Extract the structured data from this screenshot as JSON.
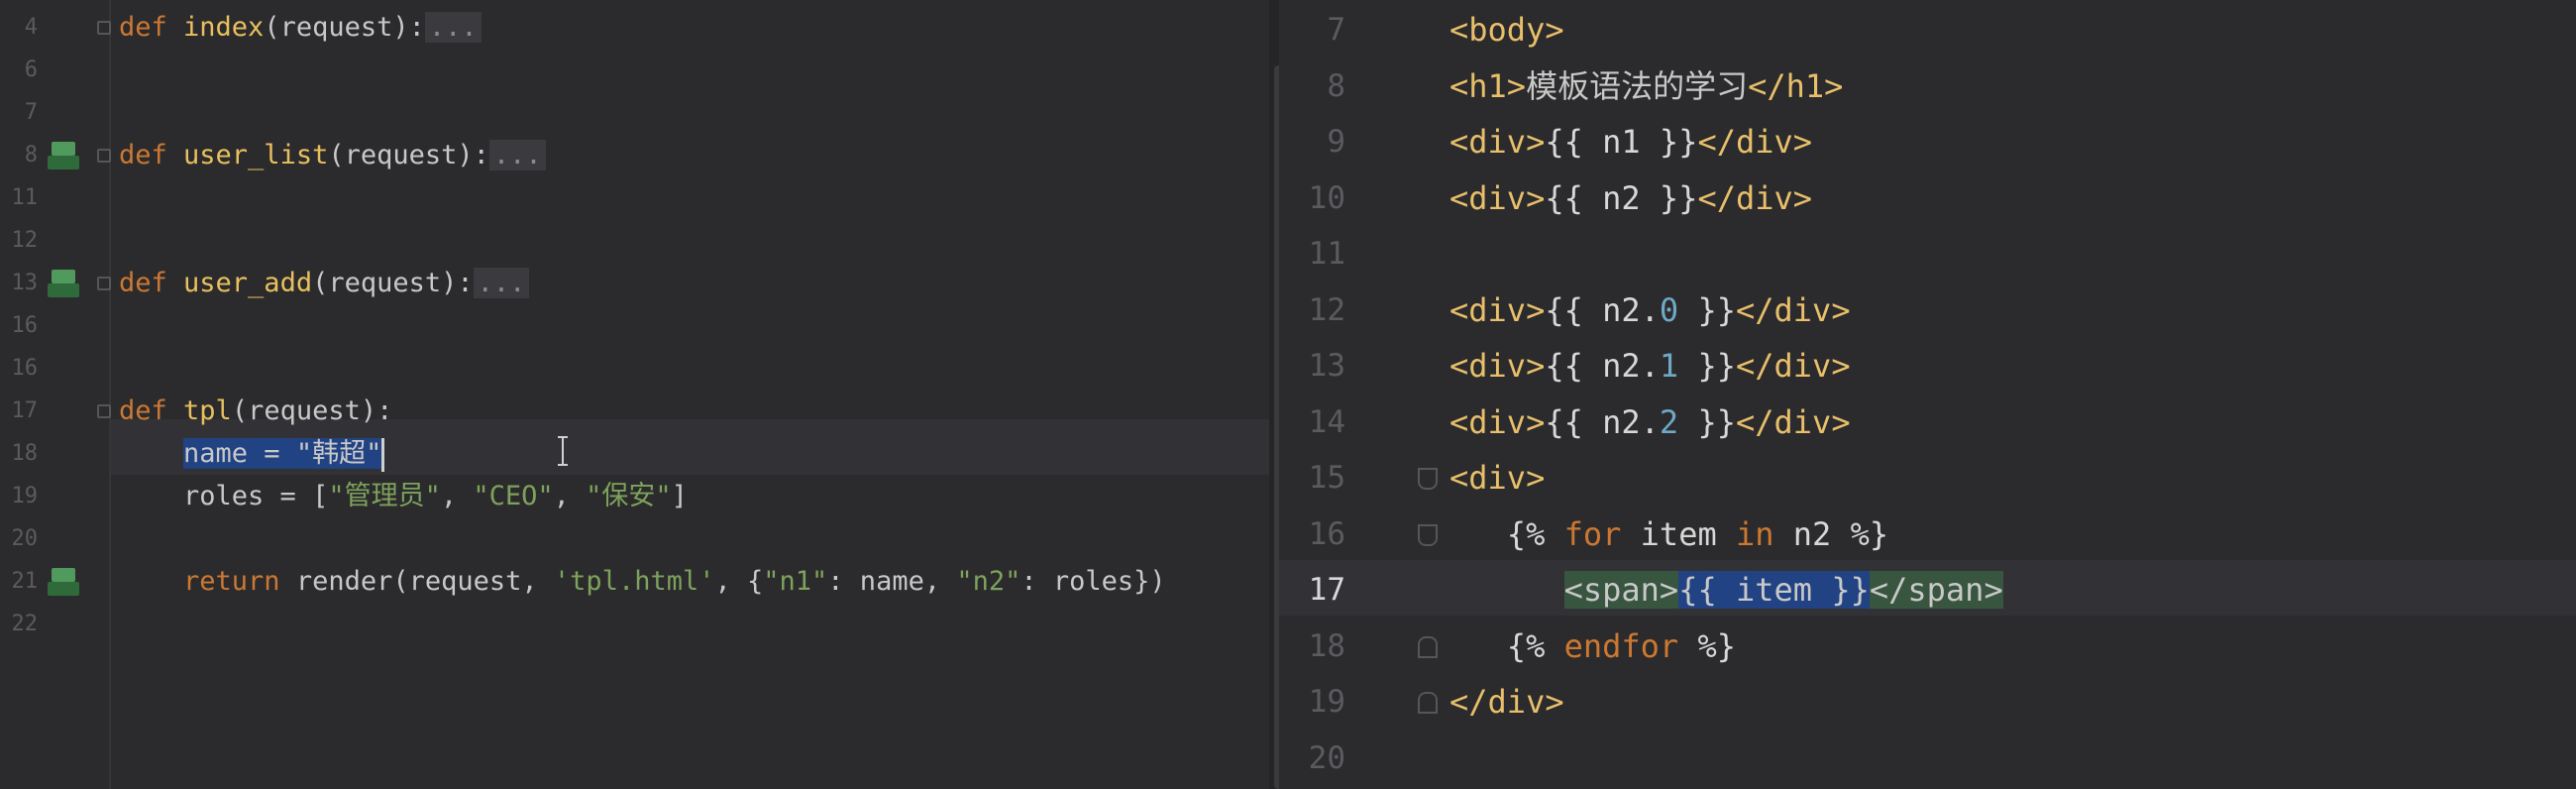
{
  "left_editor": {
    "lines": [
      {
        "n": "4",
        "parts": [
          {
            "c": "kw",
            "t": "def "
          },
          {
            "c": "fn",
            "t": "index"
          },
          {
            "c": "",
            "t": "(request):"
          },
          {
            "c": "fold",
            "t": "..."
          }
        ]
      },
      {
        "n": "6",
        "parts": []
      },
      {
        "n": "7",
        "parts": []
      },
      {
        "n": "8",
        "icon": true,
        "parts": [
          {
            "c": "kw",
            "t": "def "
          },
          {
            "c": "fn",
            "t": "user_list"
          },
          {
            "c": "",
            "t": "(request):"
          },
          {
            "c": "fold",
            "t": "..."
          }
        ]
      },
      {
        "n": "11",
        "parts": []
      },
      {
        "n": "12",
        "parts": []
      },
      {
        "n": "13",
        "icon": true,
        "parts": [
          {
            "c": "kw",
            "t": "def "
          },
          {
            "c": "fn",
            "t": "user_add"
          },
          {
            "c": "",
            "t": "(request):"
          },
          {
            "c": "fold",
            "t": "..."
          }
        ]
      },
      {
        "n": "16",
        "parts": []
      },
      {
        "n": "16",
        "parts": []
      },
      {
        "n": "17",
        "parts": [
          {
            "c": "kw",
            "t": "def "
          },
          {
            "c": "fn",
            "t": "tpl"
          },
          {
            "c": "",
            "t": "(request):"
          }
        ]
      },
      {
        "n": "18",
        "parts": [
          {
            "c": "",
            "t": "    "
          },
          {
            "c": "sel",
            "t": "name = \"韩超\""
          },
          {
            "c": "caret",
            "t": ""
          }
        ]
      },
      {
        "n": "19",
        "parts": [
          {
            "c": "",
            "t": "    roles = ["
          },
          {
            "c": "str",
            "t": "\"管理员\""
          },
          {
            "c": "",
            "t": ", "
          },
          {
            "c": "str",
            "t": "\"CEO\""
          },
          {
            "c": "",
            "t": ", "
          },
          {
            "c": "str",
            "t": "\"保安\""
          },
          {
            "c": "",
            "t": "]"
          }
        ]
      },
      {
        "n": "20",
        "parts": []
      },
      {
        "n": "21",
        "icon": true,
        "parts": [
          {
            "c": "",
            "t": "    "
          },
          {
            "c": "kw",
            "t": "return "
          },
          {
            "c": "",
            "t": "render(request, "
          },
          {
            "c": "str",
            "t": "'tpl.html'"
          },
          {
            "c": "",
            "t": ", {"
          },
          {
            "c": "str",
            "t": "\"n1\""
          },
          {
            "c": "",
            "t": ": name, "
          },
          {
            "c": "str",
            "t": "\"n2\""
          },
          {
            "c": "",
            "t": ": roles})"
          }
        ]
      },
      {
        "n": "22",
        "parts": []
      }
    ]
  },
  "right_editor": {
    "lines": [
      {
        "n": "7",
        "parts": [
          {
            "c": "tag",
            "t": "<body>"
          }
        ]
      },
      {
        "n": "8",
        "parts": [
          {
            "c": "tag",
            "t": "<h1>"
          },
          {
            "c": "",
            "t": "模板语法的学习"
          },
          {
            "c": "tag",
            "t": "</h1>"
          }
        ]
      },
      {
        "n": "9",
        "parts": [
          {
            "c": "tag",
            "t": "<div>"
          },
          {
            "c": "tpl",
            "t": "{{ n1 }}"
          },
          {
            "c": "tag",
            "t": "</div>"
          }
        ]
      },
      {
        "n": "10",
        "parts": [
          {
            "c": "tag",
            "t": "<div>"
          },
          {
            "c": "tpl",
            "t": "{{ n2 }}"
          },
          {
            "c": "tag",
            "t": "</div>"
          }
        ]
      },
      {
        "n": "11",
        "parts": []
      },
      {
        "n": "12",
        "parts": [
          {
            "c": "tag",
            "t": "<div>"
          },
          {
            "c": "tpl",
            "t": "{{ n2."
          },
          {
            "c": "num",
            "t": "0"
          },
          {
            "c": "tpl",
            "t": " }}"
          },
          {
            "c": "tag",
            "t": "</div>"
          }
        ]
      },
      {
        "n": "13",
        "parts": [
          {
            "c": "tag",
            "t": "<div>"
          },
          {
            "c": "tpl",
            "t": "{{ n2."
          },
          {
            "c": "num",
            "t": "1"
          },
          {
            "c": "tpl",
            "t": " }}"
          },
          {
            "c": "tag",
            "t": "</div>"
          }
        ]
      },
      {
        "n": "14",
        "parts": [
          {
            "c": "tag",
            "t": "<div>"
          },
          {
            "c": "tpl",
            "t": "{{ n2."
          },
          {
            "c": "num",
            "t": "2"
          },
          {
            "c": "tpl",
            "t": " }}"
          },
          {
            "c": "tag",
            "t": "</div>"
          }
        ]
      },
      {
        "n": "15",
        "fold": "up",
        "parts": [
          {
            "c": "tag",
            "t": "<div>"
          }
        ]
      },
      {
        "n": "16",
        "fold": "up",
        "parts": [
          {
            "c": "",
            "t": "   "
          },
          {
            "c": "tpl",
            "t": "{% "
          },
          {
            "c": "kw",
            "t": "for"
          },
          {
            "c": "tpl",
            "t": " item "
          },
          {
            "c": "kw",
            "t": "in"
          },
          {
            "c": "tpl",
            "t": " n2 %}"
          }
        ]
      },
      {
        "n": "17",
        "current": true,
        "parts": [
          {
            "c": "",
            "t": "      "
          },
          {
            "c": "tagmatch",
            "t": "<span>"
          },
          {
            "c": "sel",
            "t": "{{ item }}"
          },
          {
            "c": "tagmatch",
            "t": "</span>"
          }
        ]
      },
      {
        "n": "18",
        "fold": "down",
        "parts": [
          {
            "c": "",
            "t": "   "
          },
          {
            "c": "tpl",
            "t": "{% "
          },
          {
            "c": "kw",
            "t": "endfor"
          },
          {
            "c": "tpl",
            "t": " %}"
          }
        ]
      },
      {
        "n": "19",
        "fold": "down",
        "parts": [
          {
            "c": "tag",
            "t": "</div>"
          }
        ]
      },
      {
        "n": "20",
        "parts": []
      }
    ]
  }
}
